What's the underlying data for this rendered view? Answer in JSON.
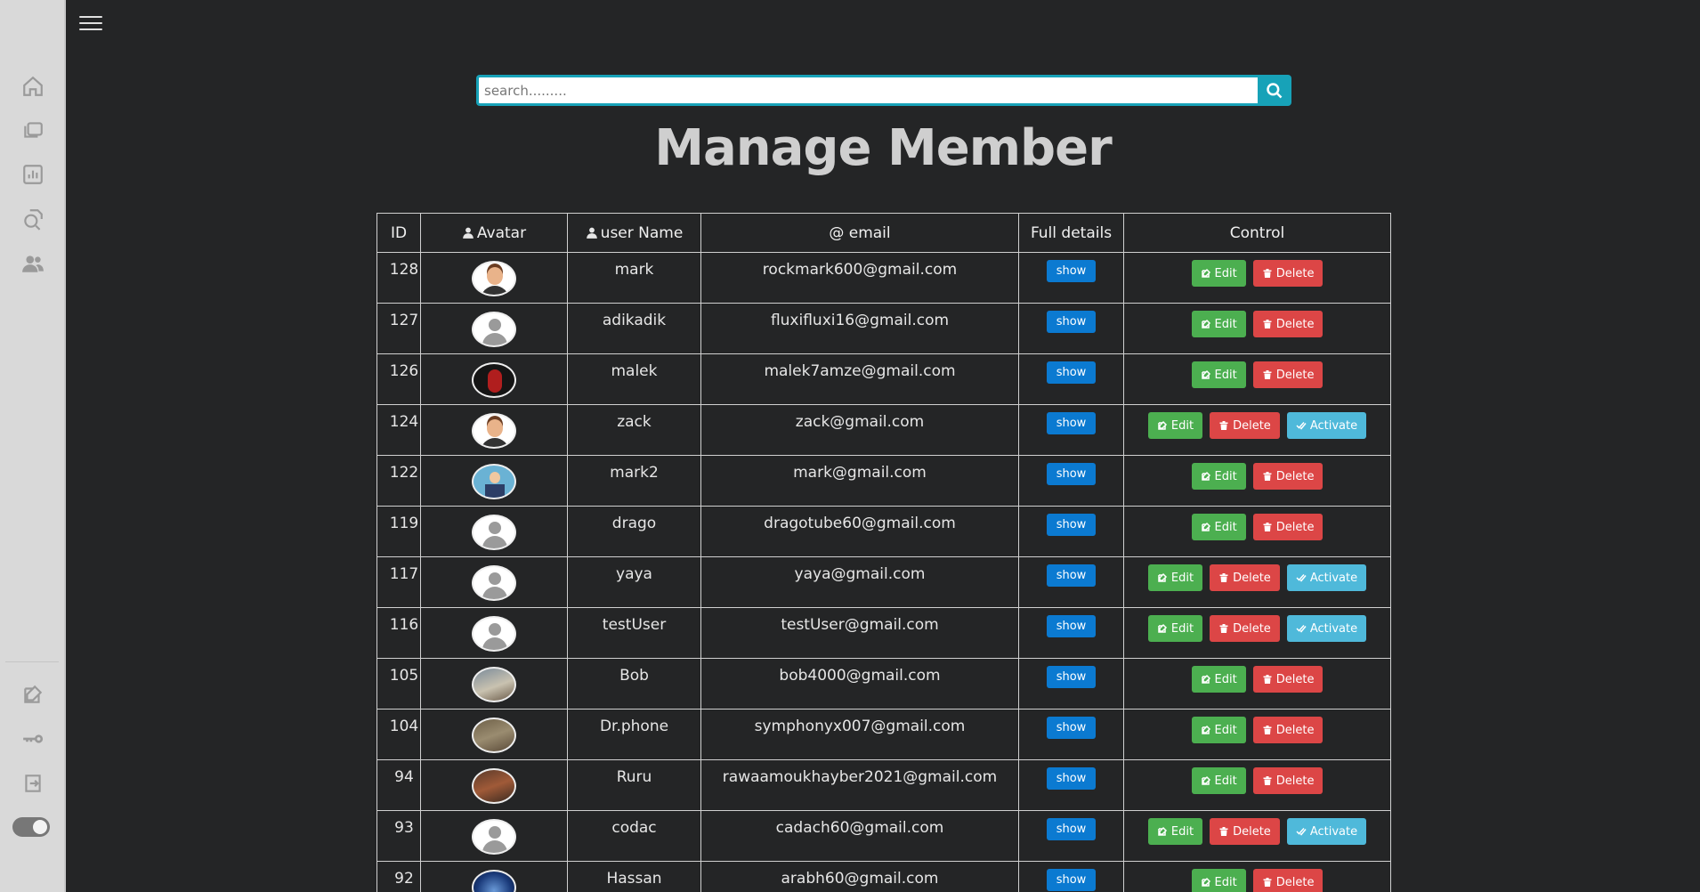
{
  "search": {
    "placeholder": "search........."
  },
  "title": "Manage Member",
  "table": {
    "headers": {
      "id": "ID",
      "avatar": "Avatar",
      "username": "user Name",
      "email": "email",
      "details": "Full details",
      "control": "Control"
    },
    "show_label": "show",
    "edit_label": "Edit",
    "delete_label": "Delete",
    "activate_label": "Activate",
    "rows": [
      {
        "id": "128",
        "name": "mark",
        "email": "rockmark600@gmail.com"
      },
      {
        "id": "127",
        "name": "adikadik",
        "email": "fluxifluxi16@gmail.com"
      },
      {
        "id": "126",
        "name": "malek",
        "email": "malek7amze@gmail.com"
      },
      {
        "id": "124",
        "name": "zack",
        "email": "zack@gmail.com"
      },
      {
        "id": "122",
        "name": "mark2",
        "email": "mark@gmail.com"
      },
      {
        "id": "119",
        "name": "drago",
        "email": "dragotube60@gmail.com"
      },
      {
        "id": "117",
        "name": "yaya",
        "email": "yaya@gmail.com"
      },
      {
        "id": "116",
        "name": "testUser",
        "email": "testUser@gmail.com"
      },
      {
        "id": "105",
        "name": "Bob",
        "email": "bob4000@gmail.com"
      },
      {
        "id": "104",
        "name": "Dr.phone",
        "email": "symphonyx007@gmail.com"
      },
      {
        "id": "94",
        "name": "Ruru",
        "email": "rawaamoukhayber2021@gmail.com"
      },
      {
        "id": "93",
        "name": "codac",
        "email": "cadach60@gmail.com"
      },
      {
        "id": "92",
        "name": "Hassan",
        "email": "arabh60@gmail.com"
      }
    ]
  },
  "sidebar": {
    "icons": [
      "home-icon",
      "layers-icon",
      "chart-icon",
      "search-doc-icon",
      "users-icon",
      "edit-icon",
      "key-icon",
      "logout-icon"
    ]
  },
  "colors": {
    "background": "#242526",
    "sidebar": "#d9d9d9",
    "accent": "#17a2b8",
    "show": "#0b7ad1",
    "edit": "#4caf50",
    "delete": "#dc4646",
    "activate": "#4fb9da"
  }
}
